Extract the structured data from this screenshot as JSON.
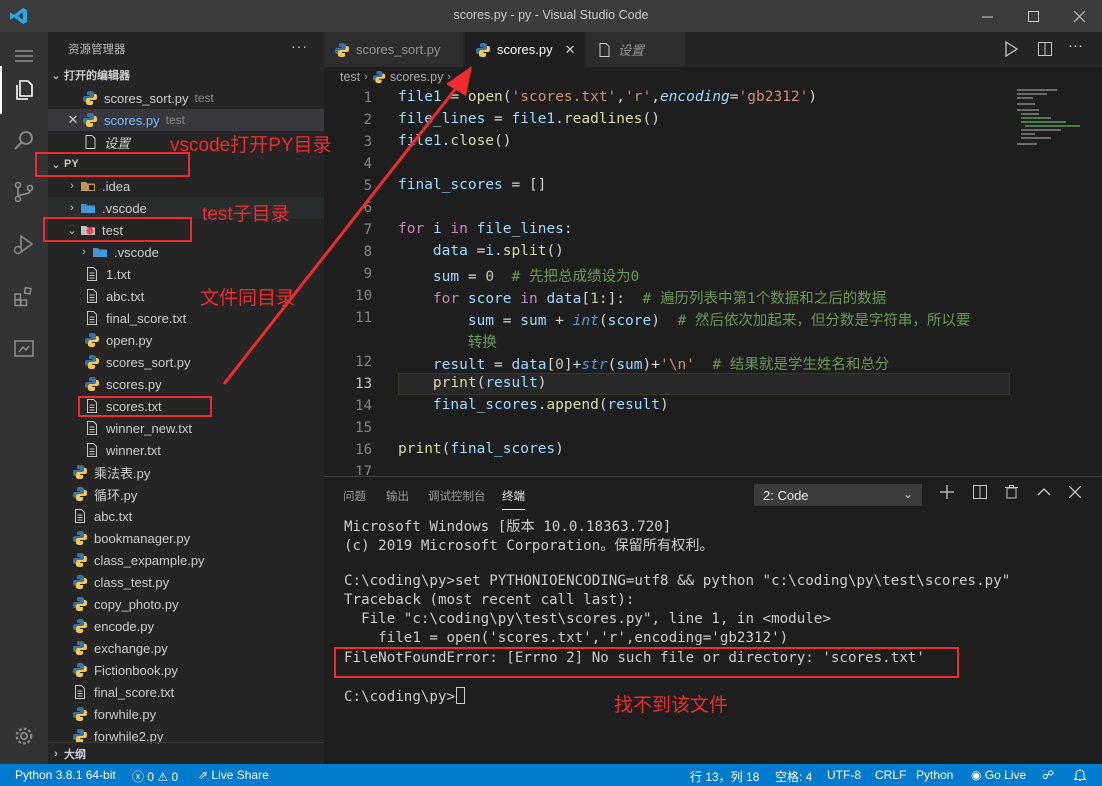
{
  "window": {
    "title": "scores.py - py - Visual Studio Code",
    "controls": [
      "minimize",
      "maximize",
      "close"
    ]
  },
  "activity_bar": {
    "items": [
      "explorer-icon",
      "search-icon",
      "source-control-icon",
      "run-debug-icon",
      "extensions-icon",
      "remote-icon"
    ],
    "bottom": "manage-gear-icon"
  },
  "sidebar": {
    "title": "资源管理器",
    "more": "···",
    "open_editors": {
      "label": "打开的编辑器",
      "items": [
        {
          "name": "scores_sort.py",
          "desc": "test"
        },
        {
          "name": "scores.py",
          "desc": "test",
          "close": "✕"
        },
        {
          "name": "设置"
        }
      ]
    },
    "folder": {
      "label": "PY",
      "items": [
        {
          "name": ".idea",
          "indent": 1,
          "type": "folder"
        },
        {
          "name": ".vscode",
          "indent": 1,
          "type": "folder"
        },
        {
          "name": "test",
          "indent": 1,
          "type": "folder-open"
        },
        {
          "name": ".vscode",
          "indent": 2,
          "type": "folder"
        },
        {
          "name": "1.txt",
          "indent": 2,
          "type": "txt"
        },
        {
          "name": "abc.txt",
          "indent": 2,
          "type": "txt"
        },
        {
          "name": "final_score.txt",
          "indent": 2,
          "type": "txt"
        },
        {
          "name": "open.py",
          "indent": 2,
          "type": "py"
        },
        {
          "name": "scores_sort.py",
          "indent": 2,
          "type": "py"
        },
        {
          "name": "scores.py",
          "indent": 2,
          "type": "py"
        },
        {
          "name": "scores.txt",
          "indent": 2,
          "type": "txt"
        },
        {
          "name": "winner_new.txt",
          "indent": 2,
          "type": "txt"
        },
        {
          "name": "winner.txt",
          "indent": 2,
          "type": "txt"
        },
        {
          "name": "乘法表.py",
          "indent": 1,
          "type": "py"
        },
        {
          "name": "循环.py",
          "indent": 1,
          "type": "py"
        },
        {
          "name": "abc.txt",
          "indent": 1,
          "type": "txt"
        },
        {
          "name": "bookmanager.py",
          "indent": 1,
          "type": "py"
        },
        {
          "name": "class_expample.py",
          "indent": 1,
          "type": "py"
        },
        {
          "name": "class_test.py",
          "indent": 1,
          "type": "py"
        },
        {
          "name": "copy_photo.py",
          "indent": 1,
          "type": "py"
        },
        {
          "name": "encode.py",
          "indent": 1,
          "type": "py"
        },
        {
          "name": "exchange.py",
          "indent": 1,
          "type": "py"
        },
        {
          "name": "Fictionbook.py",
          "indent": 1,
          "type": "py"
        },
        {
          "name": "final_score.txt",
          "indent": 1,
          "type": "txt"
        },
        {
          "name": "forwhile.py",
          "indent": 1,
          "type": "py"
        },
        {
          "name": "forwhile2.py",
          "indent": 1,
          "type": "py"
        }
      ]
    },
    "outline_label": "大纲"
  },
  "tabs": [
    {
      "label": "scores_sort.py",
      "active": false
    },
    {
      "label": "scores.py",
      "active": true,
      "close": "✕"
    },
    {
      "label": "设置",
      "active": false
    }
  ],
  "breadcrumb": {
    "folder": "test",
    "file": "scores.py",
    "more": "..."
  },
  "editor": {
    "line_numbers": [
      "1",
      "2",
      "3",
      "4",
      "5",
      "6",
      "7",
      "8",
      "9",
      "10",
      "11",
      "",
      "12",
      "13",
      "14",
      "15",
      "16",
      "17"
    ]
  },
  "panel": {
    "tabs": [
      "问题",
      "输出",
      "调试控制台",
      "终端"
    ],
    "active_tab": "终端",
    "terminal_select": "2: Code",
    "terminal_lines": [
      "Microsoft Windows [版本 10.0.18363.720]",
      "(c) 2019 Microsoft Corporation。保留所有权利。",
      "",
      "C:\\coding\\py>set PYTHONIOENCODING=utf8 && python \"c:\\coding\\py\\test\\scores.py\"",
      "Traceback (most recent call last):",
      "  File \"c:\\coding\\py\\test\\scores.py\", line 1, in <module>",
      "    file1 = open('scores.txt','r',encoding='gb2312')",
      "FileNotFoundError: [Errno 2] No such file or directory: 'scores.txt'",
      "",
      "C:\\coding\\py>"
    ]
  },
  "statusbar": {
    "python": "Python 3.8.1 64-bit",
    "errors": "0",
    "warnings": "0",
    "live_share": "Live Share",
    "position": "行 13，列 18",
    "spaces": "空格: 4",
    "encoding": "UTF-8",
    "eol": "CRLF",
    "language": "Python",
    "go_live": "Go Live"
  },
  "annotations": {
    "open_dir": "vscode打开PY目录",
    "sub_dir": "test子目录",
    "same_dir": "文件同目录",
    "not_found": "找不到该文件",
    "color": "#ef2b2b"
  },
  "colors": {
    "accent": "#007acc",
    "python_yellow": "#f7c948",
    "python_blue": "#3572a5"
  }
}
